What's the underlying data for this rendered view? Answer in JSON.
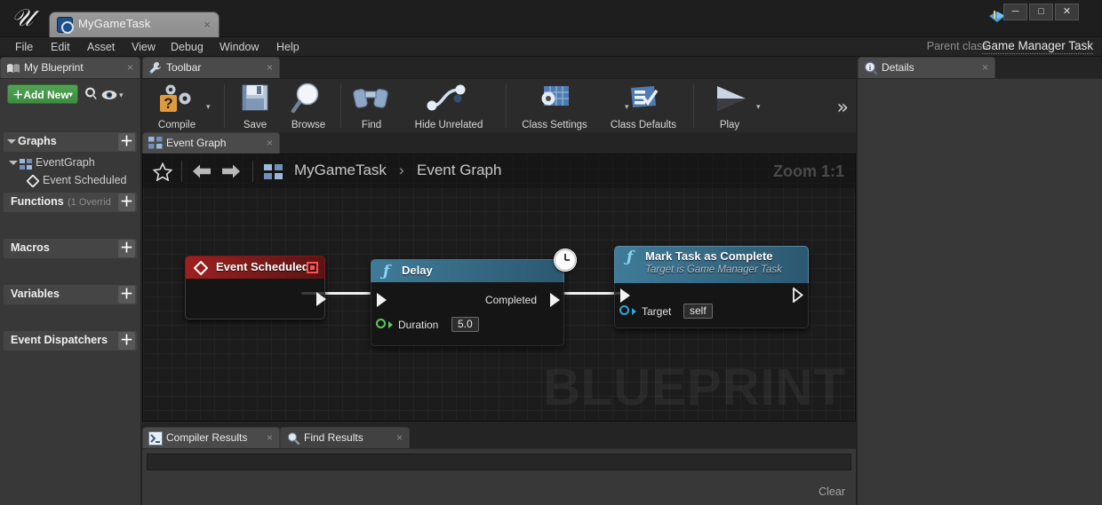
{
  "titlebar": {
    "asset_tab_label": "MyGameTask",
    "asset_tab_close": "×",
    "minimize": "─",
    "maximize": "□",
    "close": "✕"
  },
  "menubar": {
    "items": [
      {
        "label": "File"
      },
      {
        "label": "Edit"
      },
      {
        "label": "Asset"
      },
      {
        "label": "View"
      },
      {
        "label": "Debug"
      },
      {
        "label": "Window"
      },
      {
        "label": "Help"
      }
    ],
    "parent_class_label": "Parent class:",
    "parent_class_value": "Game Manager Task"
  },
  "my_blueprint": {
    "tab_label": "My Blueprint",
    "tab_close": "×",
    "add_new_label": "Add New",
    "add_new_plus": "＋",
    "caret": "▾",
    "sections": [
      {
        "label": "Graphs",
        "sub": "",
        "plus": "＋",
        "expandable": true
      },
      {
        "label": "Functions",
        "sub": "(1 Overrid",
        "plus": "＋",
        "expandable": false
      },
      {
        "label": "Macros",
        "sub": "",
        "plus": "＋",
        "expandable": false
      },
      {
        "label": "Variables",
        "sub": "",
        "plus": "＋",
        "expandable": false
      },
      {
        "label": "Event Dispatchers",
        "sub": "",
        "plus": "＋",
        "expandable": false
      }
    ],
    "tree": [
      {
        "label": "EventGraph",
        "depth": 0
      },
      {
        "label": "Event Scheduled",
        "depth": 1
      }
    ]
  },
  "toolbar": {
    "tab_label": "Toolbar",
    "tab_close": "×",
    "buttons": [
      {
        "label": "Compile",
        "icon": "compile-icon",
        "has_caret": true
      },
      {
        "label": "Save",
        "icon": "save-icon",
        "has_caret": false
      },
      {
        "label": "Browse",
        "icon": "browse-icon",
        "has_caret": false
      },
      {
        "label": "Find",
        "icon": "find-icon",
        "has_caret": false
      },
      {
        "label": "Hide Unrelated",
        "icon": "hide-unrelated-icon",
        "has_caret": true
      },
      {
        "label": "Class Settings",
        "icon": "class-settings-icon",
        "has_caret": false
      },
      {
        "label": "Class Defaults",
        "icon": "class-defaults-icon",
        "has_caret": false
      },
      {
        "label": "Play",
        "icon": "play-icon",
        "has_caret": true
      }
    ],
    "overflow": "»"
  },
  "graph": {
    "tab_label": "Event Graph",
    "tab_close": "×",
    "breadcrumb": {
      "root": "MyGameTask",
      "separator": "›",
      "current": "Event Graph"
    },
    "zoom_label": "Zoom 1:1",
    "watermark": "BLUEPRINT",
    "nodes": [
      {
        "id": "event-scheduled",
        "title": "Event Scheduled",
        "subtitle": "",
        "kind": "event",
        "header_color": "#8c1b1b",
        "out_exec": ""
      },
      {
        "id": "delay",
        "title": "Delay",
        "subtitle": "",
        "kind": "function",
        "header_color": "#356b86",
        "out_exec_label": "Completed",
        "inputs": [
          {
            "label": "Duration",
            "value": "5.0",
            "pin_color": "#5ec95e"
          }
        ]
      },
      {
        "id": "mark-task-as-complete",
        "title": "Mark Task as Complete",
        "subtitle": "Target is Game Manager Task",
        "kind": "function",
        "header_color": "#356b86",
        "inputs": [
          {
            "label": "Target",
            "value": "self",
            "pin_color": "#2fa6d8"
          }
        ]
      }
    ]
  },
  "results": {
    "tabs": [
      {
        "label": "Compiler Results",
        "close": "×",
        "active": true
      },
      {
        "label": "Find Results",
        "close": "×",
        "active": false
      }
    ],
    "clear_label": "Clear"
  },
  "details": {
    "tab_label": "Details",
    "tab_close": "×"
  },
  "colors": {
    "accent_green": "#3e8c41",
    "event_red": "#8c1b1b",
    "function_blue": "#356b86",
    "exec_wire": "#f0f0f0",
    "panel_bg": "#383838",
    "graph_bg": "#1c1c1c"
  }
}
